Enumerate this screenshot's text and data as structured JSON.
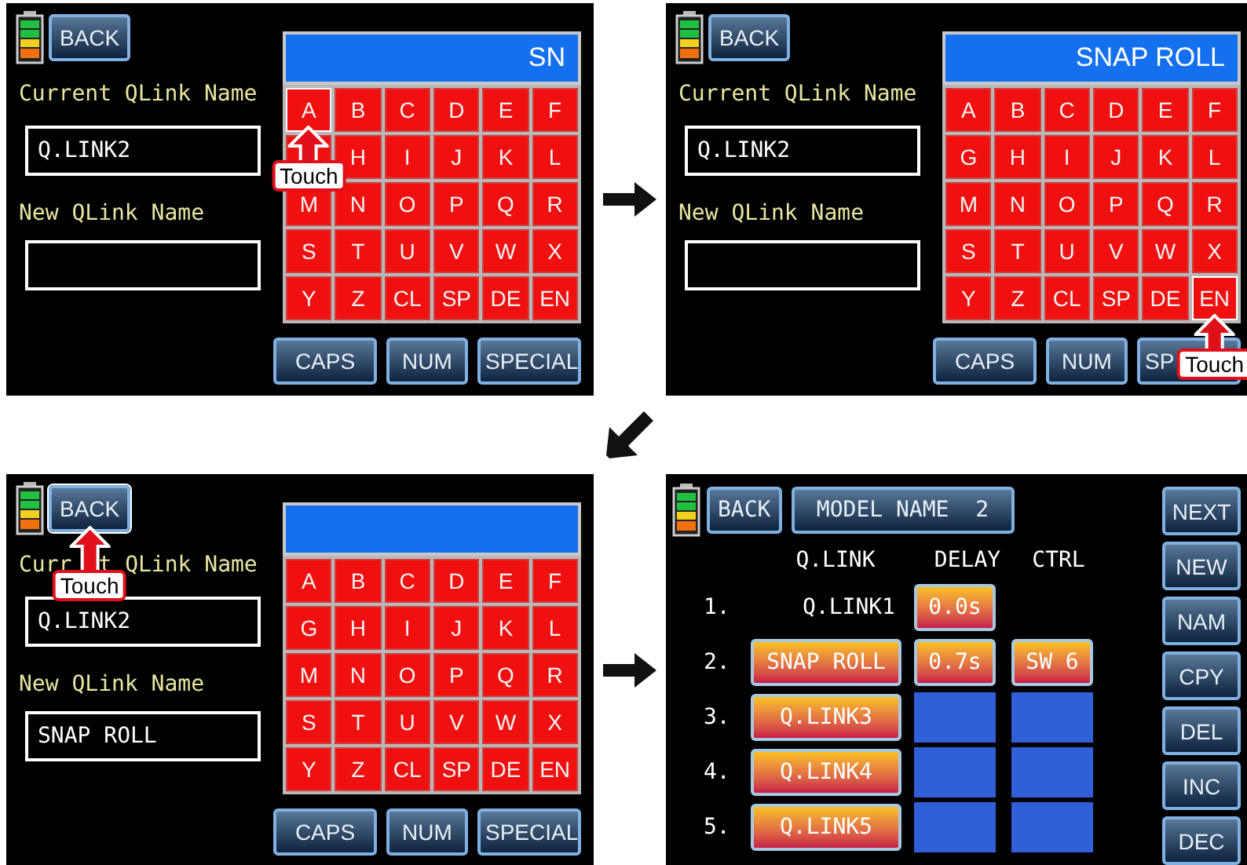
{
  "screens": [
    {
      "kind": "editor",
      "touch_label": "Touch",
      "back": {
        "label": "BACK",
        "touched": false
      },
      "display": "SN",
      "current_label": "Current QLink Name",
      "current_value": "Q.LINK2",
      "new_label": "New QLink Name",
      "keys": [
        {
          "label": "A",
          "touched": true
        },
        {
          "label": "B",
          "touched": false
        },
        {
          "label": "C",
          "touched": false
        },
        {
          "label": "D",
          "touched": false
        },
        {
          "label": "E",
          "touched": false
        },
        {
          "label": "F",
          "touched": false
        },
        {
          "touched": false
        },
        {
          "label": "H",
          "touched": false
        },
        {
          "label": "I",
          "touched": false
        },
        {
          "label": "J",
          "touched": false
        },
        {
          "label": "K",
          "touched": false
        },
        {
          "label": "L",
          "touched": false
        },
        {
          "label": "M",
          "touched": false
        },
        {
          "label": "N",
          "touched": false
        },
        {
          "label": "O",
          "touched": false
        },
        {
          "label": "P",
          "touched": false
        },
        {
          "label": "Q",
          "touched": false
        },
        {
          "label": "R",
          "touched": false
        },
        {
          "label": "S",
          "touched": false
        },
        {
          "label": "T",
          "touched": false
        },
        {
          "label": "U",
          "touched": false
        },
        {
          "label": "V",
          "touched": false
        },
        {
          "label": "W",
          "touched": false
        },
        {
          "label": "X",
          "touched": false
        },
        {
          "label": "Y",
          "touched": false
        },
        {
          "label": "Z",
          "touched": false
        },
        {
          "label": "CL",
          "touched": false
        },
        {
          "label": "SP",
          "touched": false
        },
        {
          "label": "DE",
          "touched": false
        },
        {
          "label": "EN",
          "touched": false
        }
      ],
      "bottom_buttons": [
        "CAPS",
        "NUM",
        "SPECIAL"
      ]
    },
    {
      "kind": "editor",
      "touch_label": "Touch",
      "back": {
        "label": "BACK",
        "touched": false
      },
      "display": "SNAP ROLL",
      "current_label": "Current QLink Name",
      "current_value": "Q.LINK2",
      "new_label": "New QLink Name",
      "keys": [
        {
          "label": "A",
          "touched": false
        },
        {
          "label": "B",
          "touched": false
        },
        {
          "label": "C",
          "touched": false
        },
        {
          "label": "D",
          "touched": false
        },
        {
          "label": "E",
          "touched": false
        },
        {
          "label": "F",
          "touched": false
        },
        {
          "label": "G",
          "touched": false
        },
        {
          "label": "H",
          "touched": false
        },
        {
          "label": "I",
          "touched": false
        },
        {
          "label": "J",
          "touched": false
        },
        {
          "label": "K",
          "touched": false
        },
        {
          "label": "L",
          "touched": false
        },
        {
          "label": "M",
          "touched": false
        },
        {
          "label": "N",
          "touched": false
        },
        {
          "label": "O",
          "touched": false
        },
        {
          "label": "P",
          "touched": false
        },
        {
          "label": "Q",
          "touched": false
        },
        {
          "label": "R",
          "touched": false
        },
        {
          "label": "S",
          "touched": false
        },
        {
          "label": "T",
          "touched": false
        },
        {
          "label": "U",
          "touched": false
        },
        {
          "label": "V",
          "touched": false
        },
        {
          "label": "W",
          "touched": false
        },
        {
          "label": "X",
          "touched": false
        },
        {
          "label": "Y",
          "touched": false
        },
        {
          "label": "Z",
          "touched": false
        },
        {
          "label": "CL",
          "touched": false
        },
        {
          "label": "SP",
          "touched": false
        },
        {
          "label": "DE",
          "touched": false
        },
        {
          "label": "EN",
          "touched": true
        }
      ],
      "bottom_buttons": [
        "CAPS",
        "NUM",
        "SP"
      ]
    },
    {
      "kind": "editor",
      "touch_label": "Touch",
      "back": {
        "label": "BACK",
        "touched": true
      },
      "current_label": "Curr",
      "current_label_tail": "t QLink Name",
      "current_value": "Q.LINK2",
      "new_label": "New QLink Name",
      "new_value": "SNAP ROLL",
      "keys": [
        {
          "label": "A",
          "touched": false
        },
        {
          "label": "B",
          "touched": false
        },
        {
          "label": "C",
          "touched": false
        },
        {
          "label": "D",
          "touched": false
        },
        {
          "label": "E",
          "touched": false
        },
        {
          "label": "F",
          "touched": false
        },
        {
          "label": "G",
          "touched": false
        },
        {
          "label": "H",
          "touched": false
        },
        {
          "label": "I",
          "touched": false
        },
        {
          "label": "J",
          "touched": false
        },
        {
          "label": "K",
          "touched": false
        },
        {
          "label": "L",
          "touched": false
        },
        {
          "label": "M",
          "touched": false
        },
        {
          "label": "N",
          "touched": false
        },
        {
          "label": "O",
          "touched": false
        },
        {
          "label": "P",
          "touched": false
        },
        {
          "label": "Q",
          "touched": false
        },
        {
          "label": "R",
          "touched": false
        },
        {
          "label": "S",
          "touched": false
        },
        {
          "label": "T",
          "touched": false
        },
        {
          "label": "U",
          "touched": false
        },
        {
          "label": "V",
          "touched": false
        },
        {
          "label": "W",
          "touched": false
        },
        {
          "label": "X",
          "touched": false
        },
        {
          "label": "Y",
          "touched": false
        },
        {
          "label": "Z",
          "touched": false
        },
        {
          "label": "CL",
          "touched": false
        },
        {
          "label": "SP",
          "touched": false
        },
        {
          "label": "DE",
          "touched": false
        },
        {
          "label": "EN",
          "touched": false
        }
      ],
      "bottom_buttons": [
        "CAPS",
        "NUM",
        "SPECIAL"
      ]
    },
    {
      "kind": "list",
      "back": {
        "label": "BACK",
        "touched": false
      },
      "title": "MODEL NAME  2",
      "columns": [
        "Q.LINK",
        "DELAY",
        "CTRL"
      ],
      "rows": [
        {
          "kind": "active",
          "number": "1.",
          "name": "Q.LINK1",
          "delay": "0.0s"
        },
        {
          "kind": "set",
          "number": "2.",
          "name": "SNAP ROLL",
          "delay": "0.7s",
          "ctrl": "SW 6"
        },
        {
          "kind": "empty",
          "number": "3.",
          "name": "Q.LINK3"
        },
        {
          "kind": "empty",
          "number": "4.",
          "name": "Q.LINK4"
        },
        {
          "kind": "empty",
          "number": "5.",
          "name": "Q.LINK5"
        }
      ],
      "side_buttons": [
        "NEXT",
        "NEW",
        "NAM",
        "CPY",
        "DEL",
        "INC",
        "DEC"
      ]
    }
  ],
  "arrows": [
    {
      "kind": "right"
    },
    {
      "kind": "down-left"
    },
    {
      "kind": "right"
    }
  ]
}
